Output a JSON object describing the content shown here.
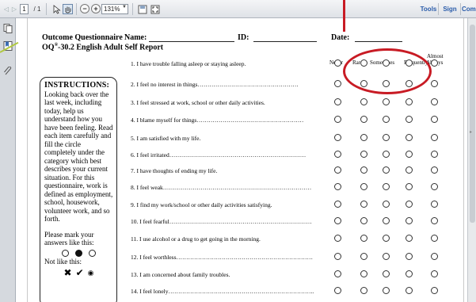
{
  "toolbar": {
    "page_current": "1",
    "page_total": "/ 1",
    "zoom": "131%",
    "links": [
      "Tools",
      "Sign",
      "Comment"
    ]
  },
  "header": {
    "title_line1": "Outcome Questionnaire",
    "title_line2_main": "OQ",
    "title_line2_sup": "®",
    "title_line2_rest": "-30.2 English Adult Self Report",
    "name_label": "Name:",
    "id_label": "ID:",
    "date_label": "Date:"
  },
  "columns": {
    "never": "Never",
    "rarely": "Rarely",
    "sometimes": "Sometimes",
    "frequently": "Frequently",
    "almost_l1": "Almost",
    "almost_l2": "Always"
  },
  "instructions": {
    "title": "INSTRUCTIONS:",
    "body": "Looking back over the last week, including today, help us understand how you have been feeling. Read each item carefully and fill the circle completely under the category which best describes your current situation. For this questionnaire, work is defined as employment, school, housework, volunteer work, and so forth.",
    "mark_like": "Please mark your answers like this:",
    "not_like": "Not like this:"
  },
  "items": [
    "1. I have trouble falling asleep or staying asleep.",
    "2. I feel no interest in things……………………………………………",
    "3. I feel stressed at work, school or other daily activities.",
    "4. I blame myself for things………………………………………………",
    "5. I am satisfied with my life.",
    "6. I feel irritated……………………………………………………………",
    "7. I have thoughts of ending my life.",
    "8. I feel weak…………………………………………………………………",
    "9. I find my work/school or other daily activities satisfying.",
    "10. I feel fearful………………………………………………………………",
    "11. I use alcohol or a drug to get going in the morning.",
    "12. I feel worthless……………………………………………………………",
    "13. I am concerned about family troubles.",
    "14. I feel lonely……………………………………………………………….."
  ]
}
